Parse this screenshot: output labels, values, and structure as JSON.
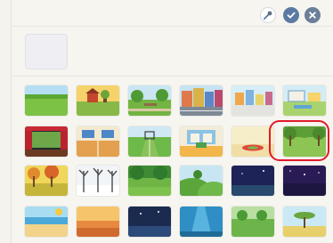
{
  "toolbar": {
    "buttons": [
      {
        "name": "eyedropper",
        "icon": "eyedropper-icon"
      },
      {
        "name": "confirm",
        "icon": "checkmark-icon"
      },
      {
        "name": "close",
        "icon": "close-icon"
      }
    ]
  },
  "selected_background": {
    "state": "empty"
  },
  "backgrounds": [
    [
      {
        "name": "grass-field",
        "icon": "grass-field-thumbnail"
      },
      {
        "name": "farm",
        "icon": "farm-thumbnail"
      },
      {
        "name": "park",
        "icon": "park-thumbnail"
      },
      {
        "name": "city-street",
        "icon": "city-street-thumbnail"
      },
      {
        "name": "town",
        "icon": "town-thumbnail"
      },
      {
        "name": "playground",
        "icon": "playground-thumbnail"
      }
    ],
    [
      {
        "name": "theater",
        "icon": "theater-thumbnail"
      },
      {
        "name": "gym",
        "icon": "gym-thumbnail"
      },
      {
        "name": "soccer-field",
        "icon": "soccer-field-thumbnail"
      },
      {
        "name": "kitchen",
        "icon": "kitchen-thumbnail"
      },
      {
        "name": "room",
        "icon": "room-thumbnail"
      },
      {
        "name": "forest-clearing",
        "icon": "forest-clearing-thumbnail",
        "selected": true
      }
    ],
    [
      {
        "name": "autumn-forest",
        "icon": "autumn-forest-thumbnail"
      },
      {
        "name": "winter-forest",
        "icon": "winter-forest-thumbnail"
      },
      {
        "name": "jungle",
        "icon": "jungle-thumbnail"
      },
      {
        "name": "hills",
        "icon": "hills-thumbnail"
      },
      {
        "name": "night-field",
        "icon": "night-field-thumbnail"
      },
      {
        "name": "night-sky",
        "icon": "night-sky-thumbnail"
      }
    ],
    [
      {
        "name": "beach",
        "icon": "beach-thumbnail"
      },
      {
        "name": "desert",
        "icon": "desert-thumbnail"
      },
      {
        "name": "night-city",
        "icon": "night-city-thumbnail"
      },
      {
        "name": "underwater",
        "icon": "underwater-thumbnail"
      },
      {
        "name": "garden",
        "icon": "garden-thumbnail"
      },
      {
        "name": "savanna",
        "icon": "savanna-thumbnail"
      }
    ]
  ],
  "colors": {
    "accent": "#5a7aa3",
    "highlight": "#e11a2a"
  }
}
